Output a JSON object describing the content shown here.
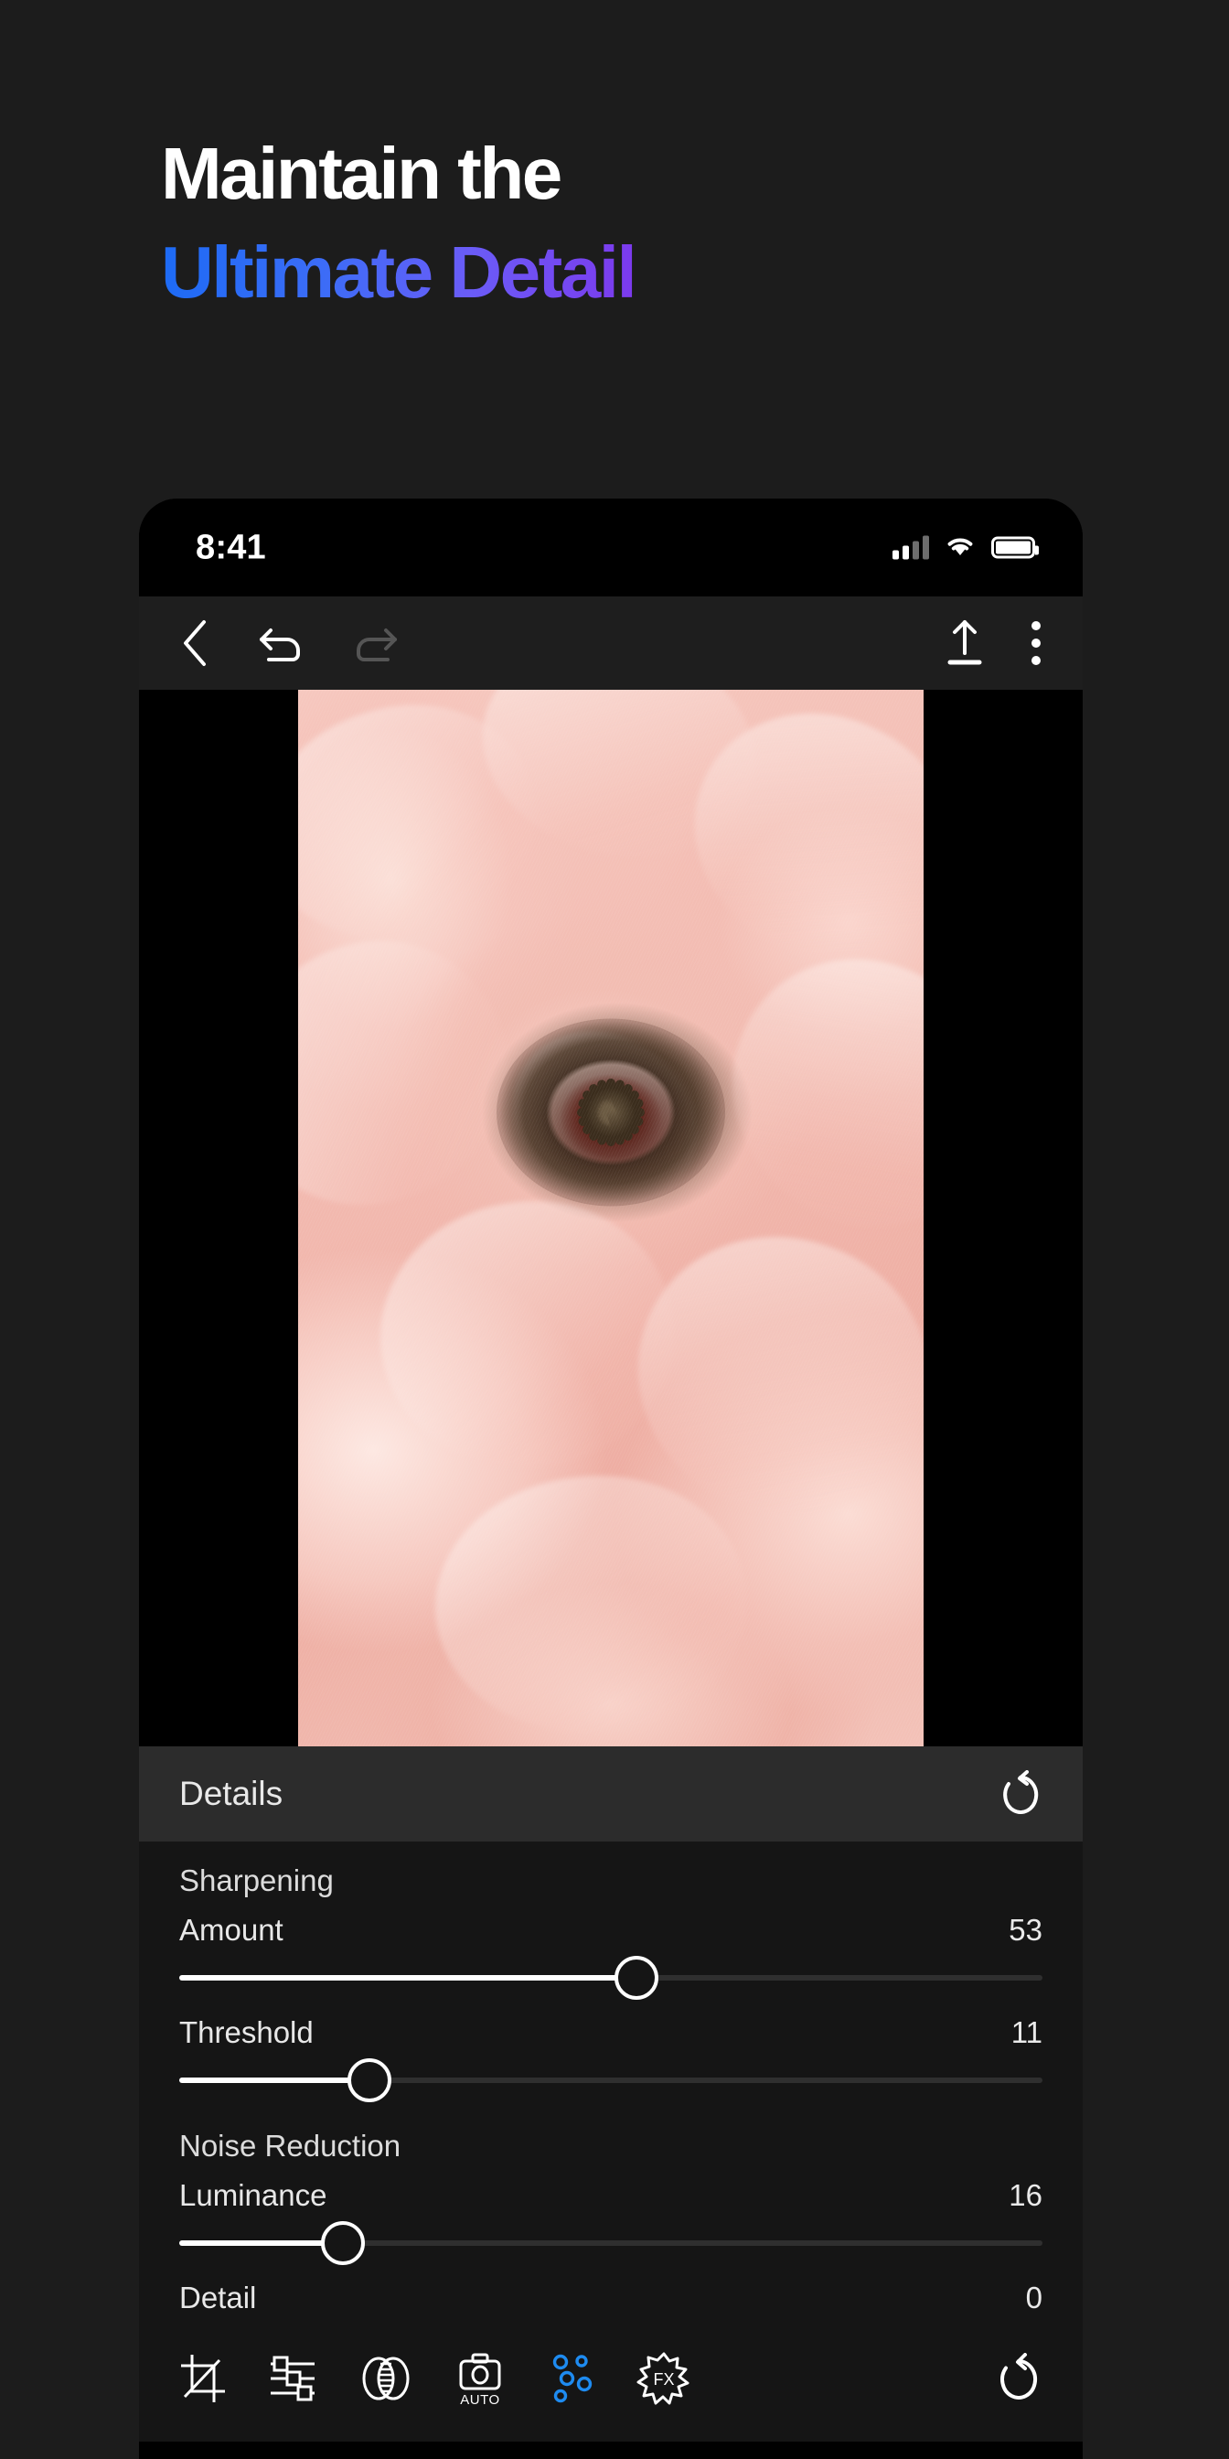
{
  "headline": {
    "line1": "Maintain the",
    "line2": "Ultimate Detail",
    "gradient_from": "#1d6bf5",
    "gradient_to": "#7c3aed",
    "line1_color": "#ffffff"
  },
  "phone": {
    "statusbar": {
      "time": "8:41",
      "signal_icon": "cellular-signal-icon",
      "signal_bars_filled": 2,
      "signal_bars_total": 4,
      "wifi_icon": "wifi-icon",
      "battery_icon": "battery-full-icon",
      "battery_level": 100
    },
    "toolbar": {
      "back_label": "back-chevron",
      "undo_label": "undo",
      "redo_label": "redo",
      "export_label": "export",
      "menu_label": "more-options",
      "undo_enabled": true,
      "redo_enabled": false
    },
    "photo": {
      "alt": "Pink ranunculus flower macro close-up"
    },
    "panel": {
      "title": "Details",
      "reset_label": "reset",
      "groups": [
        {
          "label": "Sharpening",
          "sliders": [
            {
              "label": "Amount",
              "value": "53",
              "percent": 53
            },
            {
              "label": "Threshold",
              "value": "11",
              "percent": 22
            }
          ]
        },
        {
          "label": "Noise Reduction",
          "sliders": [
            {
              "label": "Luminance",
              "value": "16",
              "percent": 19
            },
            {
              "label": "Detail",
              "value": "0",
              "percent": 0
            }
          ]
        }
      ]
    },
    "bottombar": {
      "items": [
        {
          "icon": "crop-icon",
          "label": "Crop",
          "active": false
        },
        {
          "icon": "adjust-icon",
          "label": "Adjust",
          "active": false
        },
        {
          "icon": "blend-icon",
          "label": "Blend",
          "active": false
        },
        {
          "icon": "auto-camera-icon",
          "label": "AUTO",
          "active": false
        },
        {
          "icon": "details-icon",
          "label": "Details",
          "active": true
        },
        {
          "icon": "fx-icon",
          "label": "FX",
          "active": false
        }
      ],
      "reset_label": "reset",
      "active_color": "#1e8bf0"
    }
  }
}
